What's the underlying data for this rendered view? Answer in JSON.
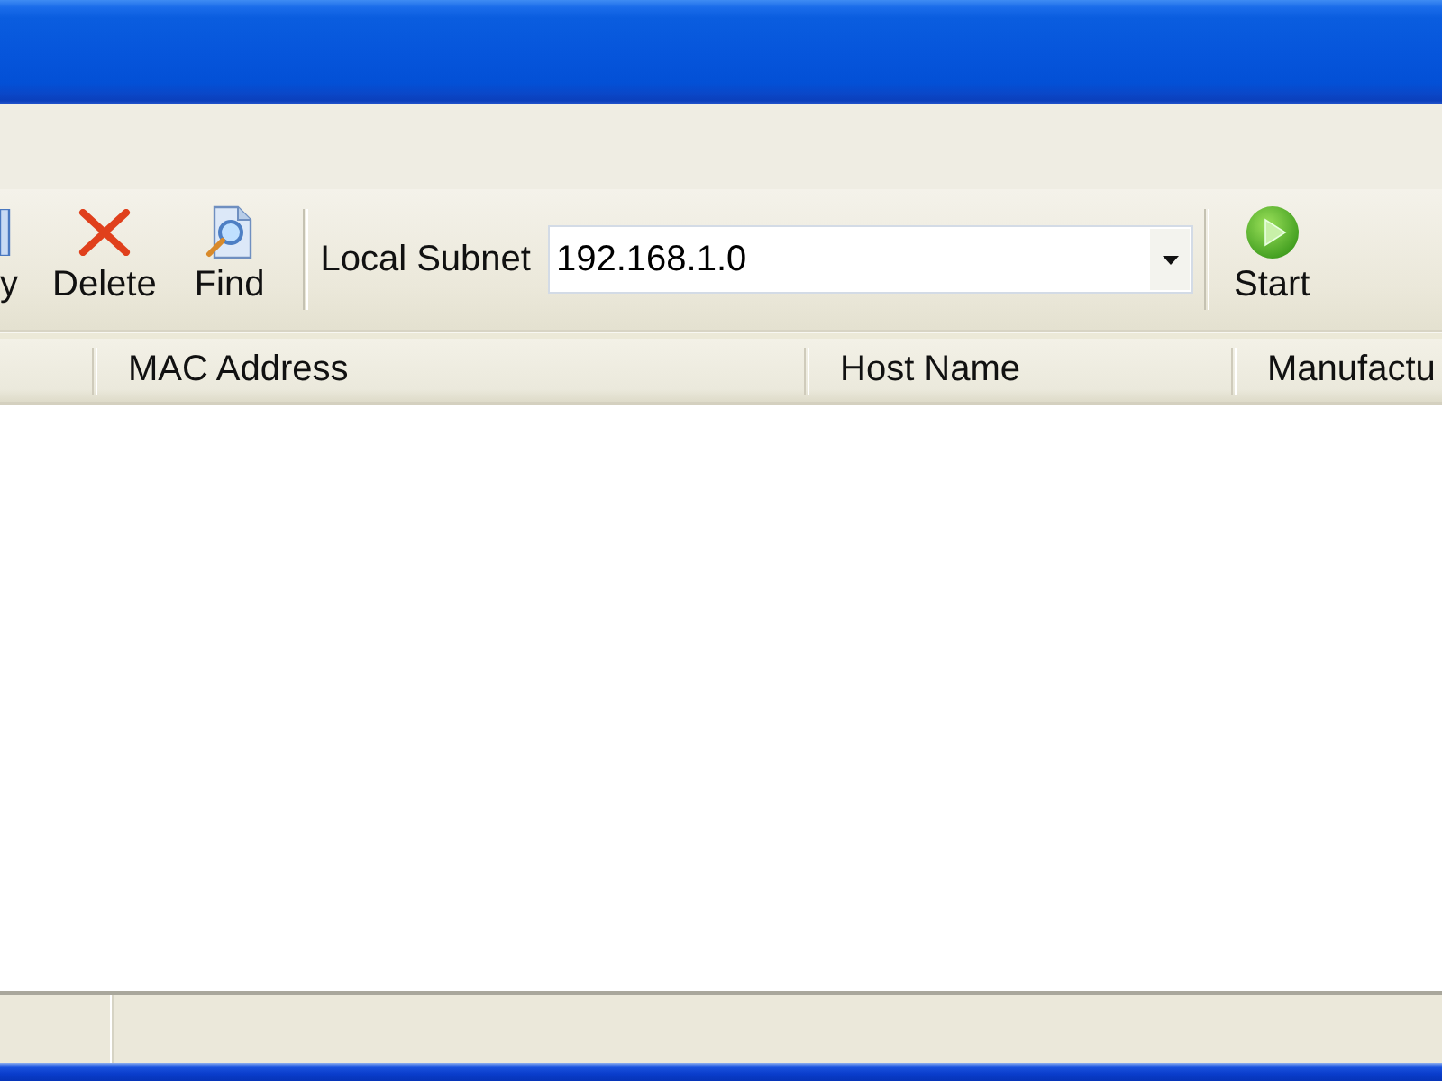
{
  "toolbar": {
    "buttons": [
      {
        "kind": "copy",
        "label": "y"
      },
      {
        "kind": "delete",
        "label": "Delete"
      },
      {
        "kind": "find",
        "label": "Find"
      }
    ],
    "subnet": {
      "label": "Local Subnet",
      "value": "192.168.1.0"
    },
    "actions": [
      {
        "kind": "start",
        "label": "Start"
      }
    ]
  },
  "table": {
    "columns": [
      "MAC Address",
      "Host Name",
      "Manufactu"
    ]
  }
}
